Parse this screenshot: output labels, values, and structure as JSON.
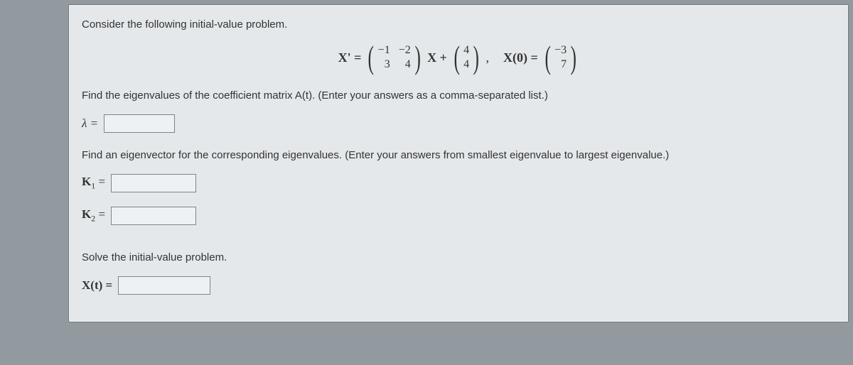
{
  "intro": "Consider the following initial-value problem.",
  "eq": {
    "lhs": "X' =",
    "A": {
      "r1c1": "−1",
      "r1c2": "−2",
      "r2c1": "3",
      "r2c2": "4"
    },
    "mid1": "X +",
    "F": {
      "r1": "4",
      "r2": "4"
    },
    "comma": ",",
    "ic_label": "X(0) =",
    "X0": {
      "r1": "−3",
      "r2": "7"
    }
  },
  "q_eig": "Find the eigenvalues of the coefficient matrix A(t). (Enter your answers as a comma-separated list.)",
  "lambda_label": "λ =",
  "q_vec": "Find an eigenvector for the corresponding eigenvalues. (Enter your answers from smallest eigenvalue to largest eigenvalue.)",
  "K1_label_pre": "K",
  "K1_sub": "1",
  "K1_eq": " =",
  "K2_sub": "2",
  "K2_eq": " =",
  "q_solve": "Solve the initial-value problem.",
  "Xt_label": "X(t) ="
}
